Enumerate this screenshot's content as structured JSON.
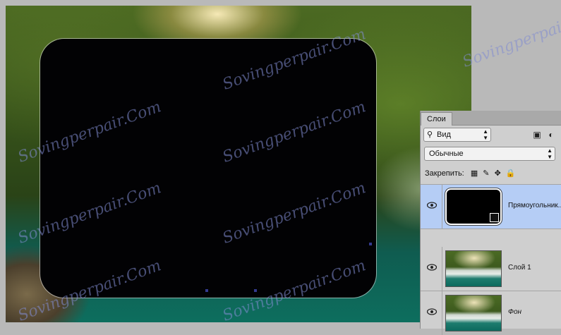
{
  "panel": {
    "tab_label": "Слои",
    "filter_label": "Вид",
    "blend_mode": "Обычные",
    "lock_label": "Закрепить:"
  },
  "layers": [
    {
      "name": "Прямоугольник...",
      "selected": true
    },
    {
      "name": "Слой 1",
      "selected": false
    },
    {
      "name": "Фон",
      "selected": false
    }
  ],
  "watermark": "Sovingperpair.Com",
  "colors": {
    "selection": "#b5cdf5",
    "panel_bg": "#cfcfcf",
    "workspace": "#b9b9b9"
  }
}
